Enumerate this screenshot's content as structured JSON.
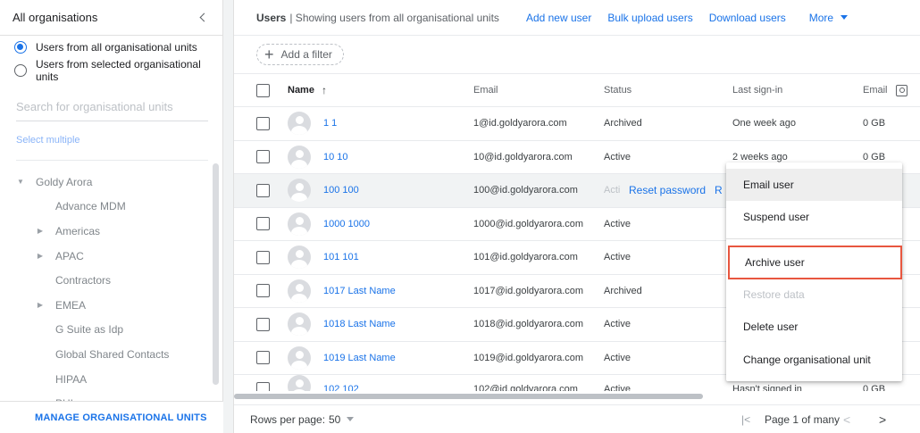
{
  "sidebar": {
    "title": "All organisations",
    "radio_all": "Users from all organisational units",
    "radio_selected": "Users from selected organisational units",
    "search_placeholder": "Search for organisational units",
    "select_multiple": "Select multiple",
    "tree": [
      {
        "label": "Goldy Arora",
        "caret": "▼",
        "level": 0
      },
      {
        "label": "Advance MDM",
        "caret": "",
        "level": 1
      },
      {
        "label": "Americas",
        "caret": "▶",
        "level": 1
      },
      {
        "label": "APAC",
        "caret": "▶",
        "level": 1
      },
      {
        "label": "Contractors",
        "caret": "",
        "level": 1
      },
      {
        "label": "EMEA",
        "caret": "▶",
        "level": 1
      },
      {
        "label": "G Suite as Idp",
        "caret": "",
        "level": 1
      },
      {
        "label": "Global Shared Contacts",
        "caret": "",
        "level": 1
      },
      {
        "label": "HIPAA",
        "caret": "",
        "level": 1
      },
      {
        "label": "PHI",
        "caret": "",
        "level": 1
      }
    ],
    "footer_link": "MANAGE ORGANISATIONAL UNITS"
  },
  "topbar": {
    "title": "Users",
    "subtitle": "| Showing users from all organisational units",
    "add_user": "Add new user",
    "bulk_upload": "Bulk upload users",
    "download": "Download users",
    "more": "More"
  },
  "filter": {
    "label": "Add a filter",
    "icon": "+"
  },
  "table": {
    "headers": {
      "name": "Name",
      "sort_arrow": "↑",
      "email": "Email",
      "status": "Status",
      "last_signin": "Last sign-in",
      "storage": "Email u"
    },
    "rows": [
      {
        "name": "1 1",
        "email": "1@id.goldyarora.com",
        "status": "Archived",
        "last": "One week ago",
        "storage": "0 GB"
      },
      {
        "name": "10 10",
        "email": "10@id.goldyarora.com",
        "status": "Active",
        "last": "2 weeks ago",
        "storage": "0 GB"
      },
      {
        "name": "100 100",
        "email": "100@id.goldyarora.com",
        "status": "Acti",
        "last": "",
        "storage": ""
      },
      {
        "name": "1000 1000",
        "email": "1000@id.goldyarora.com",
        "status": "Active",
        "last": "",
        "storage": ""
      },
      {
        "name": "101 101",
        "email": "101@id.goldyarora.com",
        "status": "Active",
        "last": "",
        "storage": ""
      },
      {
        "name": "1017 Last Name",
        "email": "1017@id.goldyarora.com",
        "status": "Archived",
        "last": "",
        "storage": ""
      },
      {
        "name": "1018 Last Name",
        "email": "1018@id.goldyarora.com",
        "status": "Active",
        "last": "",
        "storage": ""
      },
      {
        "name": "1019 Last Name",
        "email": "1019@id.goldyarora.com",
        "status": "Active",
        "last": "",
        "storage": ""
      },
      {
        "name": "102 102",
        "email": "102@id.goldyarora.com",
        "status": "Active",
        "last": "Hasn't signed in",
        "storage": "0 GB"
      }
    ],
    "inline_actions": {
      "reset": "Reset password",
      "rename": "Rena"
    }
  },
  "footer": {
    "rows_label": "Rows per page:",
    "rows_value": "50",
    "page_text": "Page 1 of many",
    "first_icon": "|<",
    "prev_icon": "<",
    "next_icon": ">"
  },
  "menu": {
    "items": [
      {
        "label": "Email user",
        "state": "hover"
      },
      {
        "label": "Suspend user",
        "state": "normal"
      },
      {
        "label": "Archive user",
        "state": "outlined"
      },
      {
        "label": "Restore data",
        "state": "disabled"
      },
      {
        "label": "Delete user",
        "state": "normal"
      },
      {
        "label": "Change organisational unit",
        "state": "normal"
      }
    ]
  },
  "colors": {
    "accent": "#1a73e8",
    "highlight_outline": "#e8563f"
  }
}
